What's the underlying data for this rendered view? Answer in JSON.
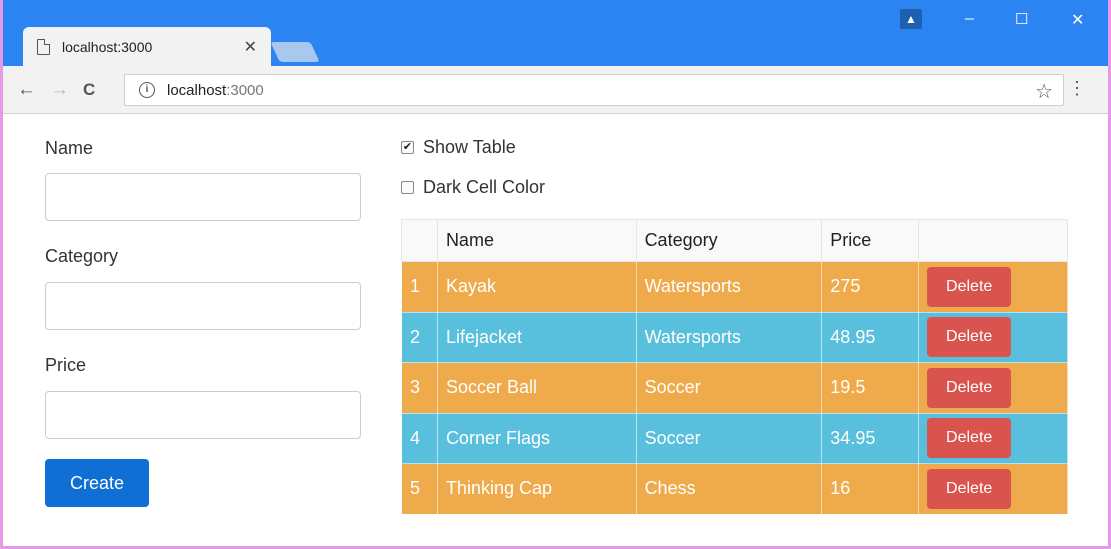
{
  "browser": {
    "tab_title": "localhost:3000",
    "tab_close": "✕",
    "url_host": "localhost",
    "url_port": ":3000",
    "controls": {
      "minimize": "–",
      "maximize": "☐",
      "close": "✕"
    },
    "icons": {
      "back": "←",
      "forward": "→",
      "reload": "C",
      "star": "☆",
      "menu": "⋮",
      "info": "i",
      "user": "▲"
    }
  },
  "form": {
    "name_label": "Name",
    "category_label": "Category",
    "price_label": "Price",
    "create_label": "Create"
  },
  "options": {
    "show_table_label": "Show Table",
    "show_table_checked": "✔",
    "dark_cell_label": "Dark Cell Color"
  },
  "table": {
    "columns": [
      "",
      "Name",
      "Category",
      "Price",
      ""
    ],
    "rows": [
      {
        "index": "1",
        "name": "Kayak",
        "category": "Watersports",
        "price": "275",
        "action": "Delete"
      },
      {
        "index": "2",
        "name": "Lifejacket",
        "category": "Watersports",
        "price": "48.95",
        "action": "Delete"
      },
      {
        "index": "3",
        "name": "Soccer Ball",
        "category": "Soccer",
        "price": "19.5",
        "action": "Delete"
      },
      {
        "index": "4",
        "name": "Corner Flags",
        "category": "Soccer",
        "price": "34.95",
        "action": "Delete"
      },
      {
        "index": "5",
        "name": "Thinking Cap",
        "category": "Chess",
        "price": "16",
        "action": "Delete"
      }
    ]
  },
  "colors": {
    "row_odd": "#efaa4b",
    "row_even": "#58bfdd",
    "delete": "#d9534f",
    "primary": "#0f6fd4",
    "titlebar": "#2b84f1"
  }
}
